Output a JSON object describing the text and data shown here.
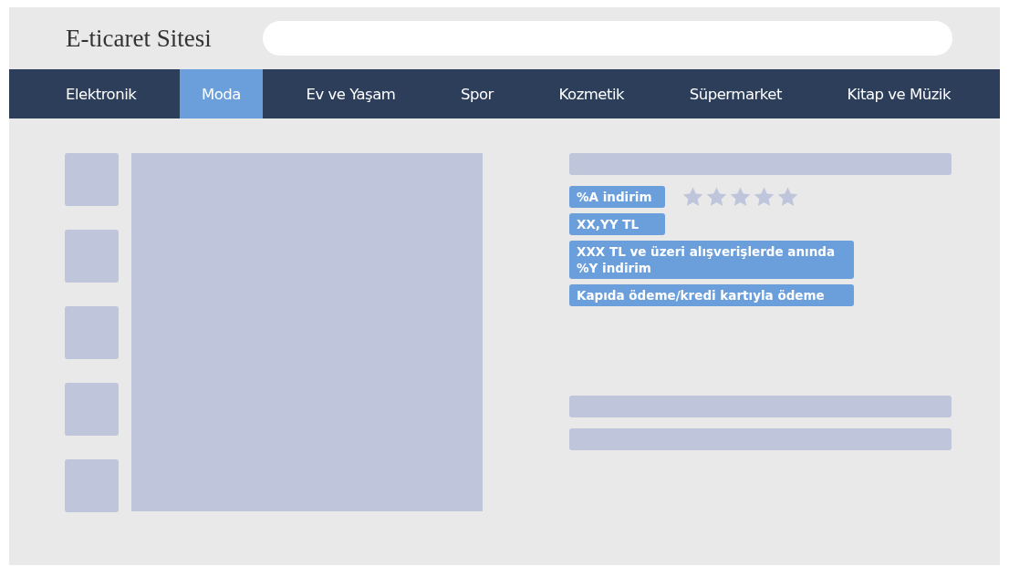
{
  "header": {
    "site_title": "E-ticaret Sitesi"
  },
  "nav": [
    {
      "label": "Elektronik",
      "selected": false
    },
    {
      "label": "Moda",
      "selected": true
    },
    {
      "label": "Ev ve Yaşam",
      "selected": false
    },
    {
      "label": "Spor",
      "selected": false
    },
    {
      "label": "Kozmetik",
      "selected": false
    },
    {
      "label": "Süpermarket",
      "selected": false
    },
    {
      "label": "Kitap ve Müzik",
      "selected": false
    }
  ],
  "product": {
    "discount": "%A indirim",
    "rating": {
      "stars": 5
    },
    "price": "XX,YY TL",
    "promo": "XXX TL ve üzeri alışverişlerde anında %Y indirim",
    "payment": "Kapıda ödeme/kredi kartıyla ödeme"
  }
}
